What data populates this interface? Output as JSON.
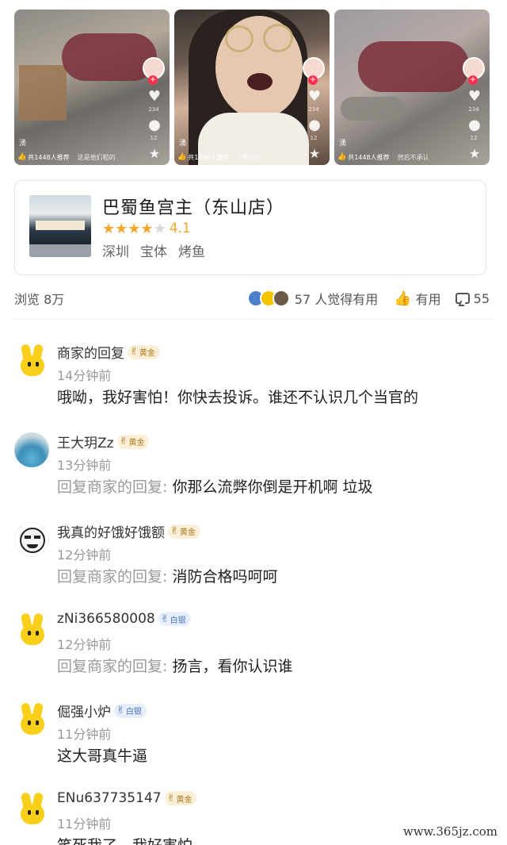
{
  "videos": [
    {
      "user": "湧",
      "rec": "共1448人推荐",
      "caption": "这是他们租的",
      "like_count": "234",
      "comment_count": "12"
    },
    {
      "user": "湧",
      "rec": "共1448人推荐",
      "caption": "1啊好的",
      "like_count": "234",
      "comment_count": "12"
    },
    {
      "user": "湧",
      "rec": "共1448人推荐",
      "caption": "然后不承认",
      "like_count": "234",
      "comment_count": "12"
    }
  ],
  "shop": {
    "name": "巴蜀鱼宫主（东山店）",
    "stars": 4.1,
    "rating": "4.1",
    "tags": [
      "深圳",
      "宝体",
      "烤鱼"
    ]
  },
  "stats": {
    "views": "浏览 8万",
    "helpful": "57 人觉得有用",
    "useful_label": "有用",
    "comment_count": "55"
  },
  "comments": [
    {
      "name": "商家的回复",
      "badge": "黄金",
      "tier": "gold",
      "time": "14分钟前",
      "reply_prefix": "",
      "text": "哦呦，我好害怕！你快去投诉。谁还不认识几个当官的",
      "avatar": "yellow"
    },
    {
      "name": "王大玥Zz",
      "badge": "黄金",
      "tier": "gold",
      "time": "13分钟前",
      "reply_prefix": "回复商家的回复: ",
      "text": "你那么流弊你倒是开机啊 垃圾",
      "avatar": "pool"
    },
    {
      "name": "我真的好饿好饿额",
      "badge": "黄金",
      "tier": "gold",
      "time": "12分钟前",
      "reply_prefix": "回复商家的回复: ",
      "text": "消防合格吗呵呵",
      "avatar": "meme"
    },
    {
      "name": "zNi366580008",
      "badge": "白银",
      "tier": "silver",
      "time": "12分钟前",
      "reply_prefix": "回复商家的回复: ",
      "text": "扬言，看你认识谁",
      "avatar": "yellow"
    },
    {
      "name": "倔强小炉",
      "badge": "白银",
      "tier": "silver",
      "time": "11分钟前",
      "reply_prefix": "",
      "text": "这大哥真牛逼",
      "avatar": "yellow"
    },
    {
      "name": "ENu637735147",
      "badge": "黄金",
      "tier": "gold",
      "time": "11分钟前",
      "reply_prefix": "",
      "text": "笑死我了，我好害怕",
      "avatar": "yellow"
    }
  ],
  "watermark": "www.365jz.com",
  "colors": {
    "star": "#f7a52b",
    "gold_badge_bg": "#fbefd8",
    "silver_badge_bg": "#e6eefb",
    "reply_prefix": "#9a9a9a"
  }
}
